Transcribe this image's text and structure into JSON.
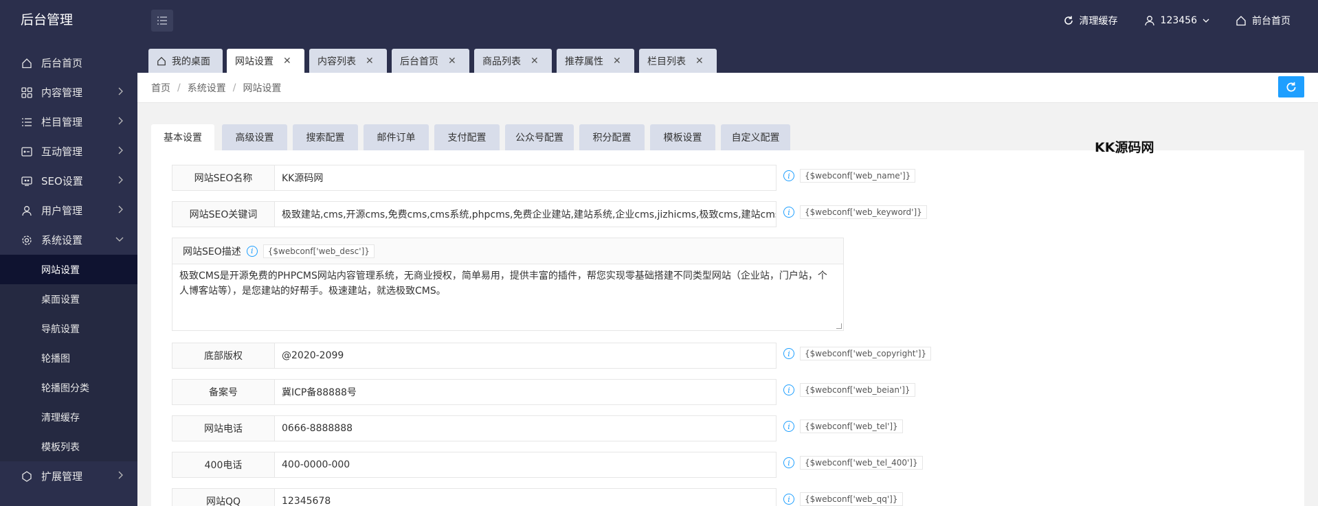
{
  "header": {
    "logo": "后台管理",
    "clear_cache": "清理缓存",
    "user": "123456",
    "front_home": "前台首页"
  },
  "sidebar": {
    "items": [
      {
        "label": "后台首页",
        "icon": "home-icon"
      },
      {
        "label": "内容管理",
        "icon": "grid-icon"
      },
      {
        "label": "栏目管理",
        "icon": "list-icon"
      },
      {
        "label": "互动管理",
        "icon": "interaction-icon"
      },
      {
        "label": "SEO设置",
        "icon": "seo-icon"
      },
      {
        "label": "用户管理",
        "icon": "user-icon"
      },
      {
        "label": "系统设置",
        "icon": "gear-icon"
      }
    ],
    "sub_items": [
      "网站设置",
      "桌面设置",
      "导航设置",
      "轮播图",
      "轮播图分类",
      "清理缓存",
      "模板列表"
    ],
    "extra_item": {
      "label": "扩展管理",
      "icon": "extension-icon"
    }
  },
  "page_tabs": [
    {
      "label": "我的桌面"
    },
    {
      "label": "网站设置"
    },
    {
      "label": "内容列表"
    },
    {
      "label": "后台首页"
    },
    {
      "label": "商品列表"
    },
    {
      "label": "推荐属性"
    },
    {
      "label": "栏目列表"
    }
  ],
  "breadcrumb": [
    "首页",
    "系统设置",
    "网站设置"
  ],
  "settings_tabs": [
    "基本设置",
    "高级设置",
    "搜索配置",
    "邮件订单",
    "支付配置",
    "公众号配置",
    "积分配置",
    "模板设置",
    "自定义配置"
  ],
  "form": {
    "seo_name": {
      "label": "网站SEO名称",
      "value": "KK源码网",
      "tag": "{$webconf['web_name']}"
    },
    "seo_keyword": {
      "label": "网站SEO关键词",
      "value": "极致建站,cms,开源cms,免费cms,cms系统,phpcms,免费企业建站,建站系统,企业cms,jizhicms,极致cms,建站cms,建站",
      "tag": "{$webconf['web_keyword']}"
    },
    "seo_desc": {
      "label": "网站SEO描述",
      "tag": "{$webconf['web_desc']}",
      "value": "极致CMS是开源免费的PHPCMS网站内容管理系统，无商业授权，简单易用，提供丰富的插件，帮您实现零基础搭建不同类型网站（企业站，门户站，个人博客站等），是您建站的好帮手。极速建站，就选极致CMS。"
    },
    "copyright": {
      "label": "底部版权",
      "value": "@2020-2099",
      "tag": "{$webconf['web_copyright']}"
    },
    "beian": {
      "label": "备案号",
      "value": "冀ICP备88888号",
      "tag": "{$webconf['web_beian']}"
    },
    "tel": {
      "label": "网站电话",
      "value": "0666-8888888",
      "tag": "{$webconf['web_tel']}"
    },
    "tel_400": {
      "label": "400电话",
      "value": "400-0000-000",
      "tag": "{$webconf['web_tel_400']}"
    },
    "qq": {
      "label": "网站QQ",
      "value": "12345678",
      "tag": "{$webconf['web_qq']}"
    }
  },
  "watermark": "KK源码网",
  "colors": {
    "sidebar_bg": "#2b2f4c",
    "active_sub": "#0f1330",
    "accent": "#1e9fff",
    "tab_bg": "#d9deea"
  }
}
